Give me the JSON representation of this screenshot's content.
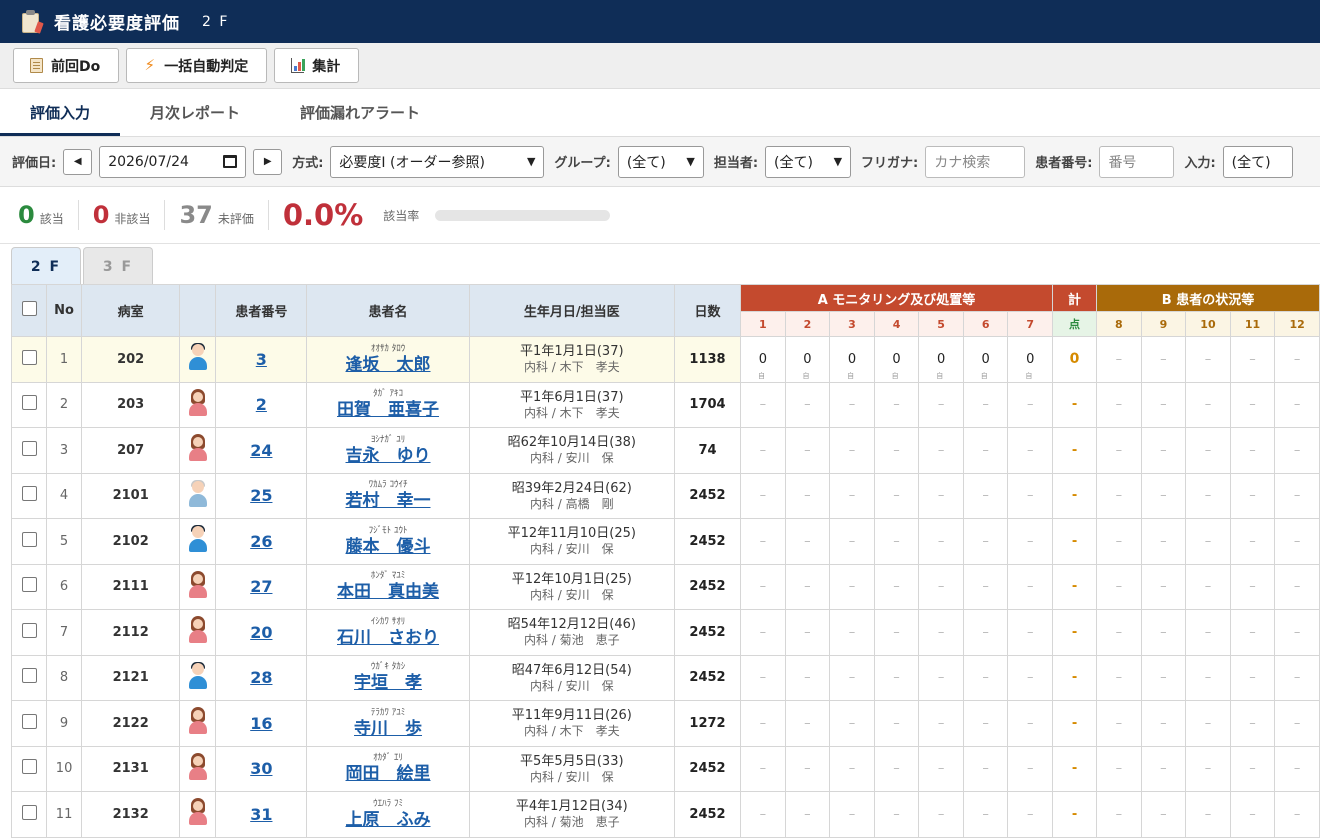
{
  "app": {
    "title": "看護必要度評価",
    "floor": "2 F"
  },
  "toolbar": {
    "prev_do": "前回Do",
    "auto_judge": "一括自動判定",
    "summary": "集計"
  },
  "tabs": [
    "評価入力",
    "月次レポート",
    "評価漏れアラート"
  ],
  "filters": {
    "date_label": "評価日:",
    "date_value": "2026/07/24",
    "method_label": "方式:",
    "method_value": "必要度Ⅰ (オーダー参照)",
    "group_label": "グループ:",
    "group_value": "(全て)",
    "staff_label": "担当者:",
    "staff_value": "(全て)",
    "kana_label": "フリガナ:",
    "kana_placeholder": "カナ検索",
    "pid_label": "患者番号:",
    "pid_placeholder": "番号",
    "input_label": "入力:",
    "input_value": "(全て)"
  },
  "summary": {
    "applicable": "0",
    "applicable_label": "該当",
    "not_applicable": "0",
    "not_applicable_label": "非該当",
    "unevaluated": "37",
    "unevaluated_label": "未評価",
    "rate": "0.0%",
    "rate_label": "該当率",
    "rate_fraction": 0.0,
    "colors": {
      "applicable": "#2b8a3e",
      "not_applicable": "#c0303a",
      "unevaluated": "#8a8a8a"
    }
  },
  "floor_tabs": [
    "2 F",
    "3 F"
  ],
  "table": {
    "headers": {
      "no": "No",
      "room": "病室",
      "pid": "患者番号",
      "name": "患者名",
      "birth": "生年月日/担当医",
      "days": "日数",
      "groupA": "A モニタリング及び処置等",
      "total": "計",
      "total_sub": "点",
      "groupB": "B 患者の状況等"
    },
    "a_cols": [
      "1",
      "2",
      "3",
      "4",
      "5",
      "6",
      "7"
    ],
    "b_cols": [
      "8",
      "9",
      "10",
      "11",
      "12"
    ],
    "self_mark": "自",
    "rows": [
      {
        "no": "1",
        "room": "202",
        "avatar": "male",
        "pid": "3",
        "kana": "ｵｵｻｶ ﾀﾛｳ",
        "name": "逢坂　太郎",
        "birth": "平1年1月1日(37)",
        "doctor": "内科 / 木下　孝夫",
        "days": "1138",
        "a": [
          "0",
          "0",
          "0",
          "0",
          "0",
          "0",
          "0"
        ],
        "total": "0"
      },
      {
        "no": "2",
        "room": "203",
        "avatar": "female",
        "pid": "2",
        "kana": "ﾀｶﾞ ｱｷｺ",
        "name": "田賀　亜喜子",
        "birth": "平1年6月1日(37)",
        "doctor": "内科 / 木下　孝夫",
        "days": "1704",
        "a": null,
        "total": "-"
      },
      {
        "no": "3",
        "room": "207",
        "avatar": "female",
        "pid": "24",
        "kana": "ﾖｼﾅｶﾞ ﾕﾘ",
        "name": "吉永　ゆり",
        "birth": "昭62年10月14日(38)",
        "doctor": "内科 / 安川　保",
        "days": "74",
        "a": null,
        "total": "-"
      },
      {
        "no": "4",
        "room": "2101",
        "avatar": "old",
        "pid": "25",
        "kana": "ﾜｶﾑﾗ ｺｳｲﾁ",
        "name": "若村　幸一",
        "birth": "昭39年2月24日(62)",
        "doctor": "内科 / 高橋　剛",
        "days": "2452",
        "a": null,
        "total": "-"
      },
      {
        "no": "5",
        "room": "2102",
        "avatar": "male",
        "pid": "26",
        "kana": "ﾌｼﾞﾓﾄ ﾕｳﾄ",
        "name": "藤本　優斗",
        "birth": "平12年11月10日(25)",
        "doctor": "内科 / 安川　保",
        "days": "2452",
        "a": null,
        "total": "-"
      },
      {
        "no": "6",
        "room": "2111",
        "avatar": "female",
        "pid": "27",
        "kana": "ﾎﾝﾀﾞ ﾏﾕﾐ",
        "name": "本田　真由美",
        "birth": "平12年10月1日(25)",
        "doctor": "内科 / 安川　保",
        "days": "2452",
        "a": null,
        "total": "-"
      },
      {
        "no": "7",
        "room": "2112",
        "avatar": "female",
        "pid": "20",
        "kana": "ｲｼｶﾜ ｻｵﾘ",
        "name": "石川　さおり",
        "birth": "昭54年12月12日(46)",
        "doctor": "内科 / 菊池　恵子",
        "days": "2452",
        "a": null,
        "total": "-"
      },
      {
        "no": "8",
        "room": "2121",
        "avatar": "male",
        "pid": "28",
        "kana": "ｳｶﾞｷ ﾀｶｼ",
        "name": "宇垣　孝",
        "birth": "昭47年6月12日(54)",
        "doctor": "内科 / 安川　保",
        "days": "2452",
        "a": null,
        "total": "-"
      },
      {
        "no": "9",
        "room": "2122",
        "avatar": "female",
        "pid": "16",
        "kana": "ﾃﾗｶﾜ ｱﾕﾐ",
        "name": "寺川　歩",
        "birth": "平11年9月11日(26)",
        "doctor": "内科 / 木下　孝夫",
        "days": "1272",
        "a": null,
        "total": "-"
      },
      {
        "no": "10",
        "room": "2131",
        "avatar": "female",
        "pid": "30",
        "kana": "ｵｶﾀﾞ ｴﾘ",
        "name": "岡田　絵里",
        "birth": "平5年5月5日(33)",
        "doctor": "内科 / 安川　保",
        "days": "2452",
        "a": null,
        "total": "-"
      },
      {
        "no": "11",
        "room": "2132",
        "avatar": "female",
        "pid": "31",
        "kana": "ｳｴﾊﾗ ﾌﾐ",
        "name": "上原　ふみ",
        "birth": "平4年1月12日(34)",
        "doctor": "内科 / 菊池　恵子",
        "days": "2452",
        "a": null,
        "total": "-"
      }
    ]
  }
}
